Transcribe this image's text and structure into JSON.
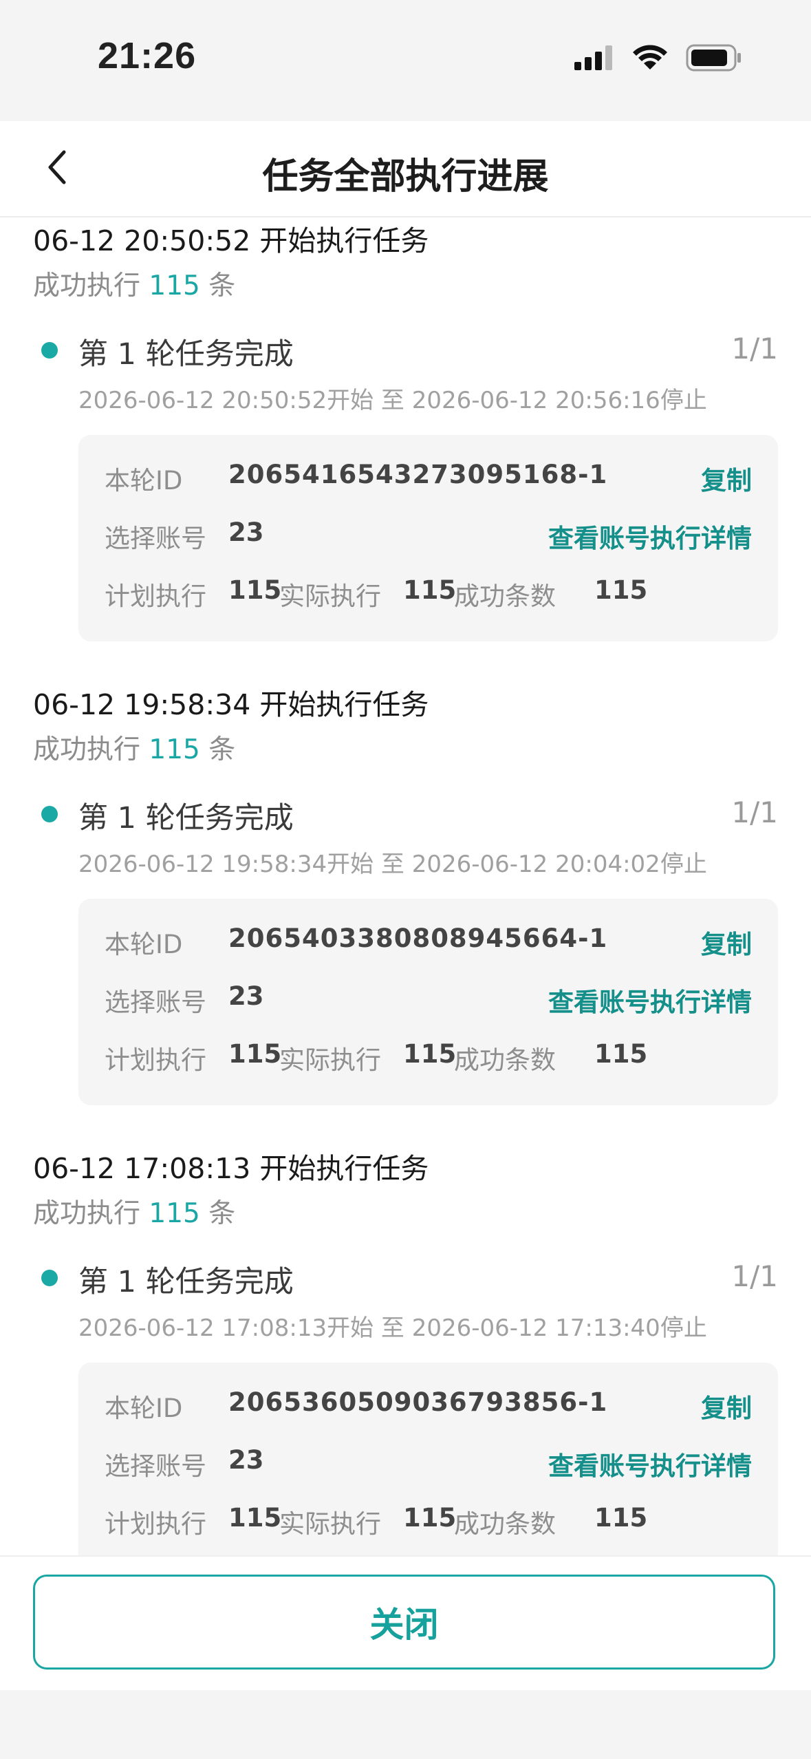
{
  "status_bar": {
    "time": "21:26"
  },
  "header": {
    "title": "任务全部执行进展"
  },
  "labels": {
    "success_prefix": "成功执行",
    "success_suffix": "条",
    "round_id": "本轮ID",
    "selected_accounts": "选择账号",
    "planned": "计划执行",
    "actual": "实际执行",
    "success_rows": "成功条数",
    "copy": "复制",
    "view_details": "查看账号执行详情"
  },
  "tasks": [
    {
      "header": "06-12 20:50:52 开始执行任务",
      "success_count": "115",
      "round_title": "第 1 轮任务完成",
      "round_progress": "1/1",
      "round_time": "2026-06-12 20:50:52开始 至 2026-06-12 20:56:16停止",
      "round_id": "2065416543273095168-1",
      "accounts": "23",
      "planned": "115",
      "actual": "115",
      "success": "115"
    },
    {
      "header": "06-12 19:58:34 开始执行任务",
      "success_count": "115",
      "round_title": "第 1 轮任务完成",
      "round_progress": "1/1",
      "round_time": "2026-06-12 19:58:34开始 至 2026-06-12 20:04:02停止",
      "round_id": "2065403380808945664-1",
      "accounts": "23",
      "planned": "115",
      "actual": "115",
      "success": "115"
    },
    {
      "header": "06-12 17:08:13 开始执行任务",
      "success_count": "115",
      "round_title": "第 1 轮任务完成",
      "round_progress": "1/1",
      "round_time": "2026-06-12 17:08:13开始 至 2026-06-12 17:13:40停止",
      "round_id": "2065360509036793856-1",
      "accounts": "23",
      "planned": "115",
      "actual": "115",
      "success": "115"
    }
  ],
  "footer": {
    "close_label": "关闭"
  },
  "colors": {
    "accent": "#1aa6a2",
    "link": "#148f8a"
  },
  "icons": [
    "back-arrow-icon",
    "signal-icon",
    "wifi-icon",
    "battery-icon",
    "status-dot-icon"
  ]
}
